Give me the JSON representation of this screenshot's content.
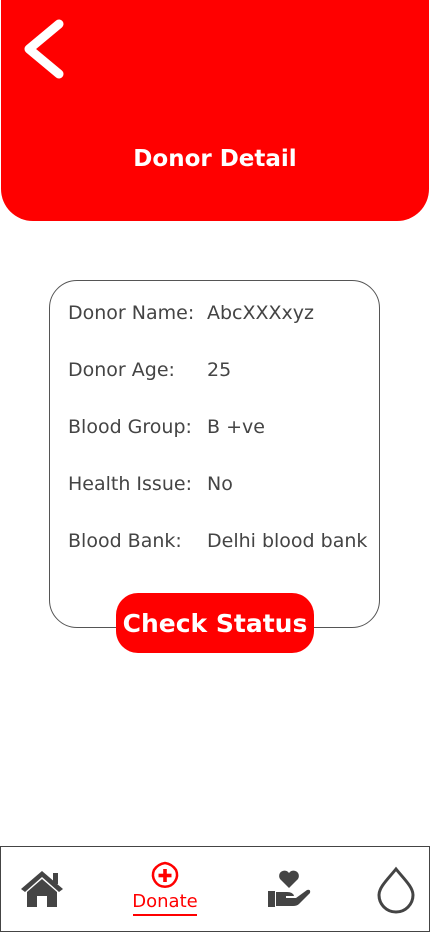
{
  "header": {
    "title": "Donor Detail",
    "background_color": "#ff0000",
    "back_icon": "chevron-left-icon"
  },
  "donor": {
    "fields": [
      {
        "label": "Donor Name:",
        "value": "AbcXXXxyz"
      },
      {
        "label": "Donor Age:",
        "value": "25"
      },
      {
        "label": "Blood Group:",
        "value": "B +ve"
      },
      {
        "label": "Health Issue:",
        "value": "No"
      },
      {
        "label": "Blood Bank:",
        "value": "Delhi blood bank"
      }
    ]
  },
  "actions": {
    "check_status_label": "Check Status"
  },
  "bottom_nav": {
    "items": [
      {
        "icon": "home-icon",
        "label": ""
      },
      {
        "icon": "plus-drop-icon",
        "label": "Donate",
        "active": true
      },
      {
        "icon": "hand-heart-icon",
        "label": ""
      },
      {
        "icon": "blood-drop-icon",
        "label": ""
      }
    ],
    "active_color": "#ff0000",
    "icon_color": "#444444"
  }
}
